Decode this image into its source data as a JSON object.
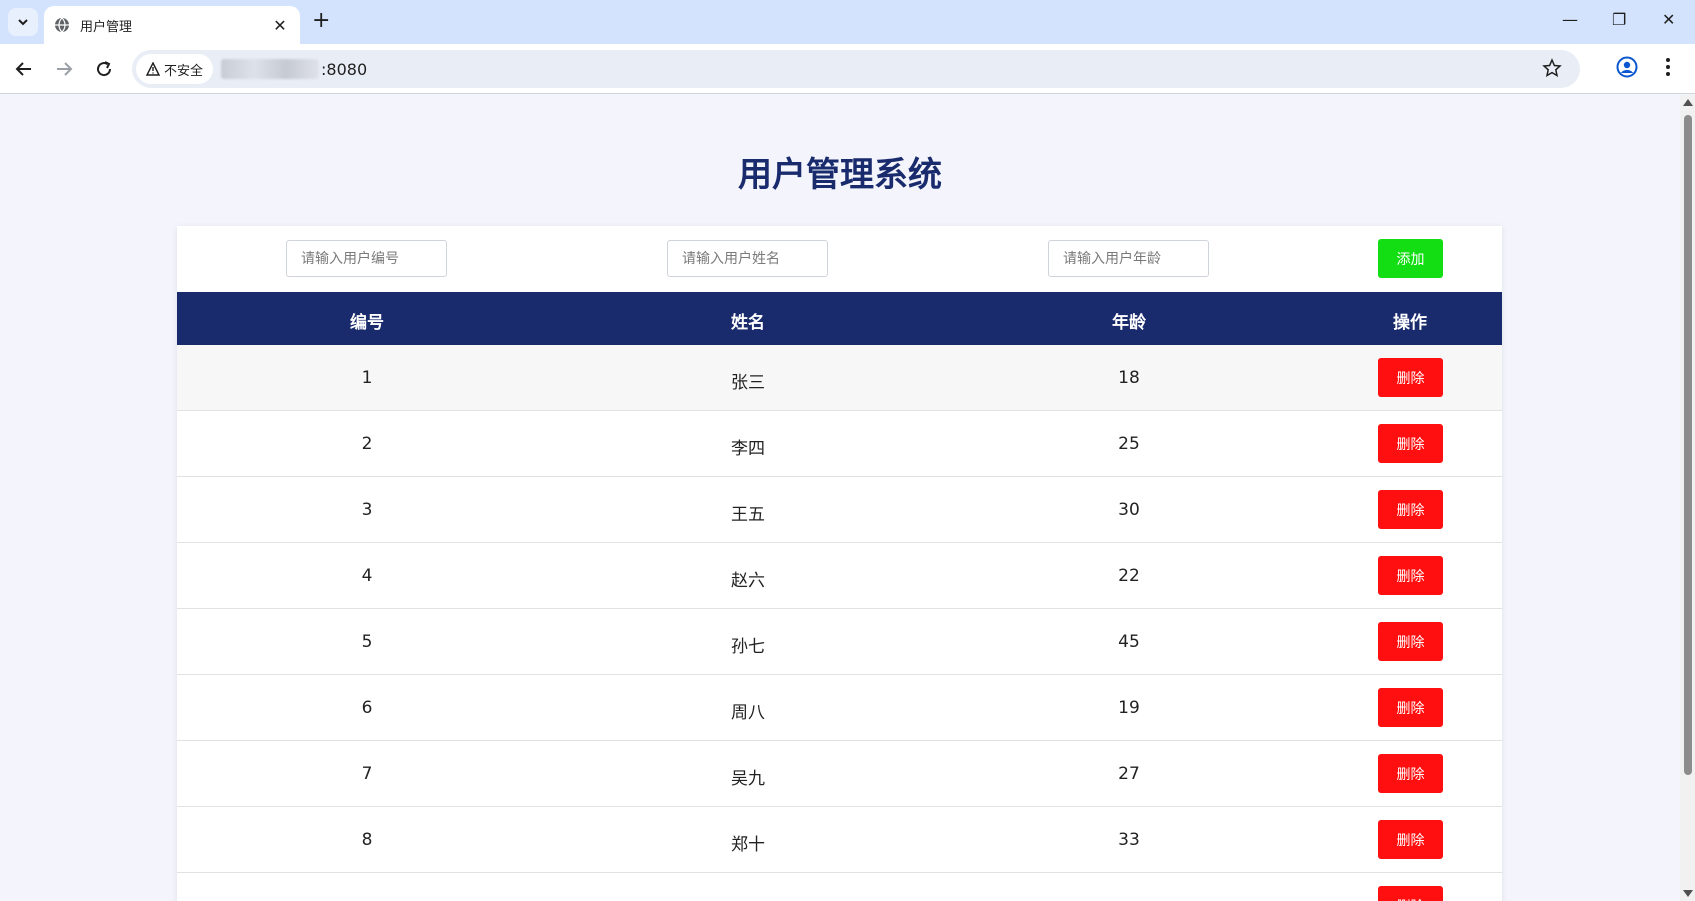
{
  "browser": {
    "tab_title": "用户管理",
    "security_label": "不安全",
    "url_suffix": ":8080"
  },
  "page": {
    "title": "用户管理系统"
  },
  "form": {
    "id_placeholder": "请输入用户编号",
    "name_placeholder": "请输入用户姓名",
    "age_placeholder": "请输入用户年龄",
    "add_label": "添加"
  },
  "table": {
    "headers": [
      "编号",
      "姓名",
      "年龄",
      "操作"
    ],
    "delete_label": "删除",
    "rows": [
      {
        "id": "1",
        "name": "张三",
        "age": "18"
      },
      {
        "id": "2",
        "name": "李四",
        "age": "25"
      },
      {
        "id": "3",
        "name": "王五",
        "age": "30"
      },
      {
        "id": "4",
        "name": "赵六",
        "age": "22"
      },
      {
        "id": "5",
        "name": "孙七",
        "age": "45"
      },
      {
        "id": "6",
        "name": "周八",
        "age": "19"
      },
      {
        "id": "7",
        "name": "吴九",
        "age": "27"
      },
      {
        "id": "8",
        "name": "郑十",
        "age": "33"
      }
    ]
  },
  "colors": {
    "header_bg": "#1a2b6d",
    "add_button": "#13de13",
    "delete_button": "#ff0f0f",
    "page_bg": "#f3f4fc"
  }
}
